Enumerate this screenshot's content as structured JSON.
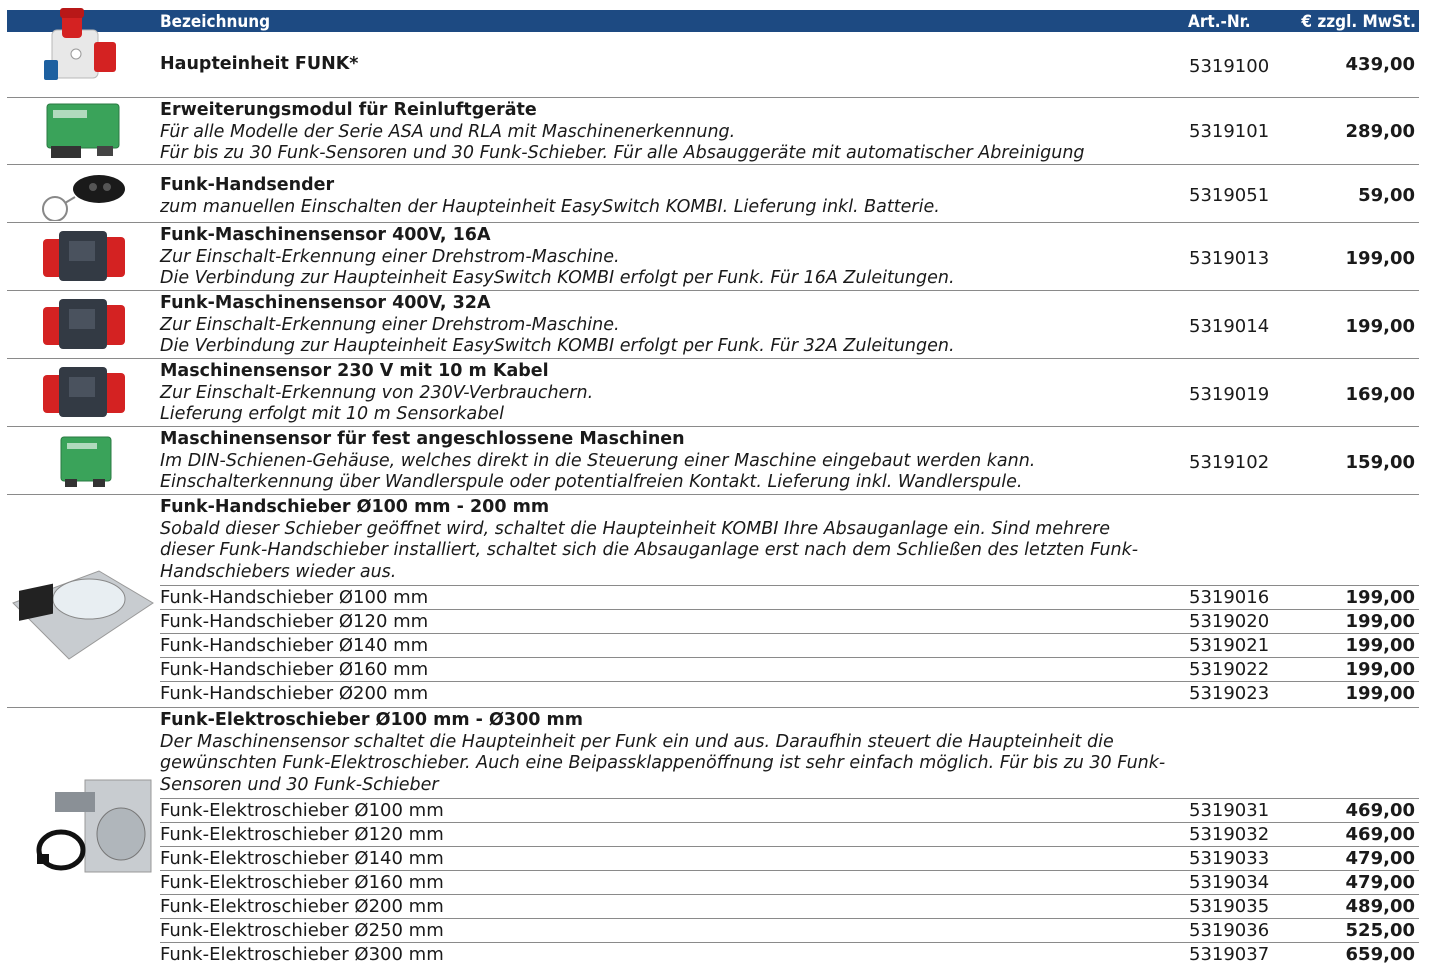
{
  "header": {
    "name": "Bezeichnung",
    "art": "Art.-Nr.",
    "price": "€ zzgl. MwSt."
  },
  "products": [
    {
      "title": "Haupteinheit FUNK*",
      "desc": [],
      "art": "5319100",
      "price": "439,00"
    },
    {
      "title": "Erweiterungsmodul für Reinluftgeräte",
      "desc": [
        "Für alle Modelle der Serie ASA und RLA mit Maschinenerkennung.",
        "Für bis zu 30 Funk-Sensoren und 30 Funk-Schieber. Für alle Absauggeräte mit automatischer Abreinigung"
      ],
      "art": "5319101",
      "price": "289,00"
    },
    {
      "title": "Funk-Handsender",
      "desc": [
        "zum manuellen Einschalten der Haupteinheit EasySwitch KOMBI. Lieferung inkl. Batterie."
      ],
      "art": "5319051",
      "price": "59,00"
    },
    {
      "title": "Funk-Maschinensensor 400V, 16A",
      "desc": [
        "Zur Einschalt-Erkennung einer Drehstrom-Maschine.",
        "Die Verbindung zur Haupteinheit EasySwitch KOMBI erfolgt per Funk. Für 16A Zuleitungen."
      ],
      "art": "5319013",
      "price": "199,00"
    },
    {
      "title": "Funk-Maschinensensor 400V, 32A",
      "desc": [
        "Zur Einschalt-Erkennung einer Drehstrom-Maschine.",
        "Die Verbindung zur Haupteinheit EasySwitch KOMBI erfolgt per Funk. Für 32A Zuleitungen."
      ],
      "art": "5319014",
      "price": "199,00"
    },
    {
      "title": "Maschinensensor 230 V mit 10 m Kabel",
      "desc": [
        "Zur Einschalt-Erkennung von 230V-Verbrauchern.",
        "Lieferung erfolgt mit 10 m Sensorkabel"
      ],
      "art": "5319019",
      "price": "169,00"
    },
    {
      "title": "Maschinensensor für fest angeschlossene Maschinen",
      "desc": [
        "Im DIN-Schienen-Gehäuse, welches direkt in die Steuerung einer Maschine eingebaut werden kann.",
        "Einschalterkennung über Wandlerspule oder potentialfreien Kontakt. Lieferung inkl. Wandlerspule."
      ],
      "art": "5319102",
      "price": "159,00"
    }
  ],
  "groups": [
    {
      "title": "Funk-Handschieber Ø100 mm - 200 mm",
      "desc": [
        "Sobald dieser Schieber geöffnet wird, schaltet die Haupteinheit KOMBI Ihre Absauganlage ein. Sind mehrere",
        "dieser Funk-Handschieber installiert, schaltet sich die Absauganlage erst nach dem Schließen des letzten Funk-",
        "Handschiebers wieder aus."
      ],
      "items": [
        {
          "label": "Funk-Handschieber Ø100 mm",
          "art": "5319016",
          "price": "199,00"
        },
        {
          "label": "Funk-Handschieber Ø120 mm",
          "art": "5319020",
          "price": "199,00"
        },
        {
          "label": "Funk-Handschieber Ø140 mm",
          "art": "5319021",
          "price": "199,00"
        },
        {
          "label": "Funk-Handschieber Ø160 mm",
          "art": "5319022",
          "price": "199,00"
        },
        {
          "label": "Funk-Handschieber Ø200 mm",
          "art": "5319023",
          "price": "199,00"
        }
      ]
    },
    {
      "title": "Funk-Elektroschieber Ø100 mm - Ø300 mm",
      "desc": [
        "Der Maschinensensor schaltet die Haupteinheit per Funk ein und aus. Daraufhin steuert die Haupteinheit die",
        "gewünschten Funk-Elektroschieber. Auch eine Beipassklappenöffnung ist sehr einfach möglich. Für bis zu 30 Funk-",
        "Sensoren und 30 Funk-Schieber"
      ],
      "items": [
        {
          "label": "Funk-Elektroschieber Ø100 mm",
          "art": "5319031",
          "price": "469,00"
        },
        {
          "label": "Funk-Elektroschieber Ø120 mm",
          "art": "5319032",
          "price": "469,00"
        },
        {
          "label": "Funk-Elektroschieber Ø140 mm",
          "art": "5319033",
          "price": "479,00"
        },
        {
          "label": "Funk-Elektroschieber Ø160 mm",
          "art": "5319034",
          "price": "479,00"
        },
        {
          "label": "Funk-Elektroschieber Ø200 mm",
          "art": "5319035",
          "price": "489,00"
        },
        {
          "label": "Funk-Elektroschieber Ø250 mm",
          "art": "5319036",
          "price": "525,00"
        },
        {
          "label": "Funk-Elektroschieber Ø300 mm",
          "art": "5319037",
          "price": "659,00"
        }
      ]
    }
  ]
}
